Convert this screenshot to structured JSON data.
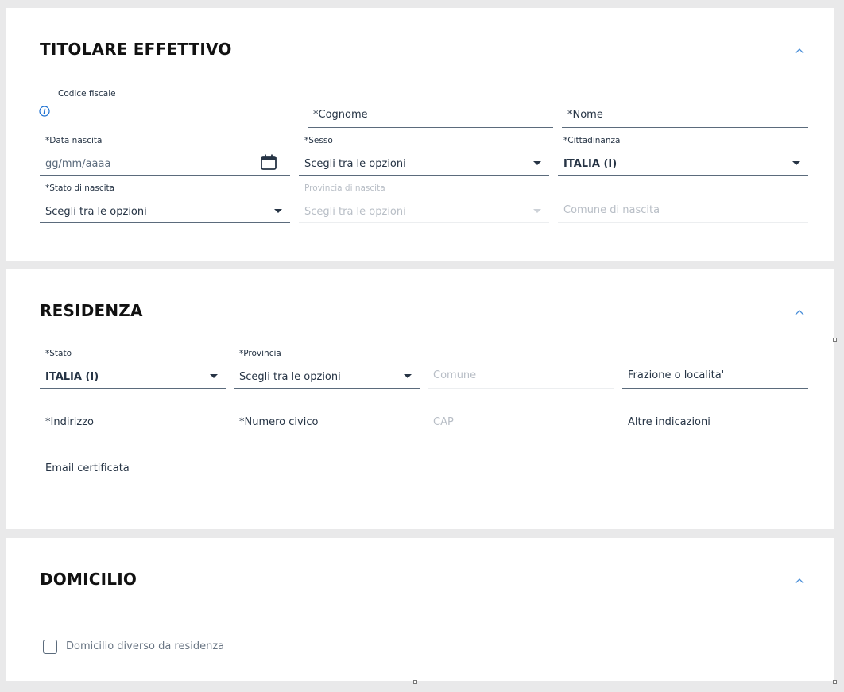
{
  "titolare": {
    "title": "TITOLARE EFFETTIVO",
    "codice_fiscale_label": "Codice fiscale",
    "cognome_placeholder": "*Cognome",
    "nome_placeholder": "*Nome",
    "data_nascita_label": "*Data nascita",
    "data_nascita_placeholder": "gg/mm/aaaa",
    "sesso_label": "*Sesso",
    "sesso_value": "Scegli tra le opzioni",
    "cittadinanza_label": "*Cittadinanza",
    "cittadinanza_value": "ITALIA (I)",
    "stato_nascita_label": "*Stato di nascita",
    "stato_nascita_value": "Scegli tra le opzioni",
    "provincia_nascita_label": "Provincia di nascita",
    "provincia_nascita_value": "Scegli tra le opzioni",
    "comune_nascita_placeholder": "Comune di nascita"
  },
  "residenza": {
    "title": "RESIDENZA",
    "stato_label": "*Stato",
    "stato_value": "ITALIA (I)",
    "provincia_label": "*Provincia",
    "provincia_value": "Scegli tra le opzioni",
    "comune_placeholder": "Comune",
    "frazione_placeholder": "Frazione o localita'",
    "indirizzo_placeholder": "*Indirizzo",
    "civico_placeholder": "*Numero civico",
    "cap_placeholder": "CAP",
    "altre_placeholder": "Altre indicazioni",
    "email_placeholder": "Email certificata"
  },
  "domicilio": {
    "title": "DOMICILIO",
    "checkbox_label": "Domicilio diverso da residenza"
  },
  "colors": {
    "accent": "#1a6fd1",
    "line": "#5b6b7c",
    "text": "#263445"
  }
}
